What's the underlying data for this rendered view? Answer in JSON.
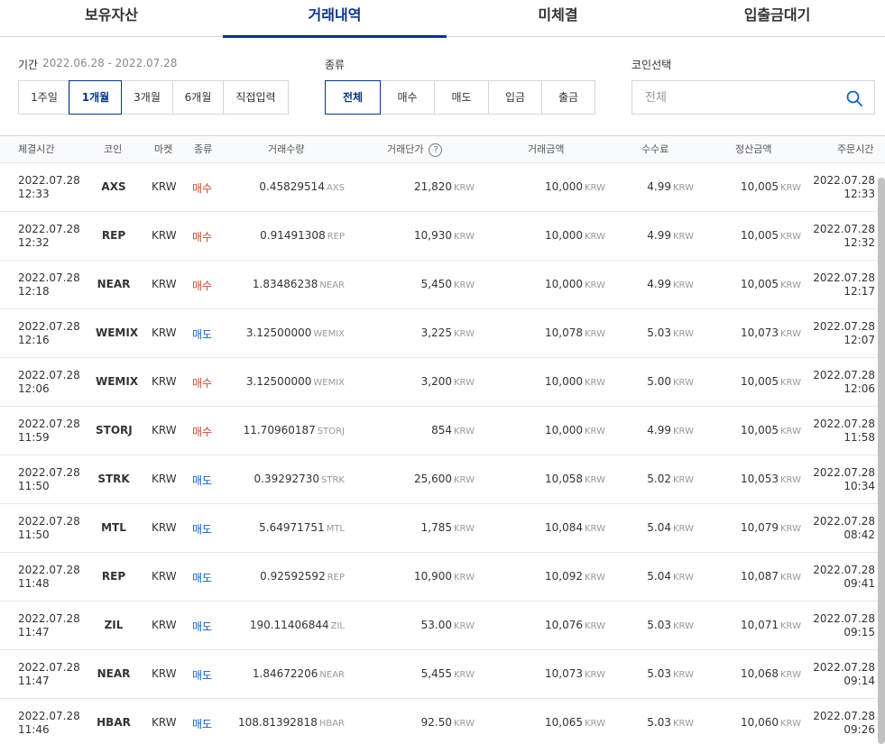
{
  "tabs": [
    {
      "label": "보유자산",
      "active": false
    },
    {
      "label": "거래내역",
      "active": true
    },
    {
      "label": "미체결",
      "active": false
    },
    {
      "label": "입출금대기",
      "active": false
    }
  ],
  "filters": {
    "period_label": "기간",
    "period_range": "2022.06.28 - 2022.07.28",
    "period_options": [
      "1주일",
      "1개월",
      "3개월",
      "6개월",
      "직접입력"
    ],
    "period_selected": "1개월",
    "type_label": "종류",
    "type_options": [
      "전체",
      "매수",
      "매도",
      "입금",
      "출금"
    ],
    "type_selected": "전체",
    "coin_label": "코인선택",
    "coin_placeholder": "전체"
  },
  "table": {
    "headers": {
      "time": "체결시간",
      "coin": "코인",
      "market": "마켓",
      "type": "종류",
      "qty": "거래수량",
      "price": "거래단가",
      "amount": "거래금액",
      "fee": "수수료",
      "settle": "정산금액",
      "order_time": "주문시간"
    },
    "help_glyph": "?",
    "rows": [
      {
        "date": "2022.07.28",
        "time": "12:33",
        "coin": "AXS",
        "market": "KRW",
        "type": "매수",
        "side": "buy",
        "qty": "0.45829514",
        "qty_unit": "AXS",
        "price": "21,820",
        "amount": "10,000",
        "fee": "4.99",
        "settle": "10,005",
        "unit": "KRW",
        "odate": "2022.07.28",
        "otime": "12:33"
      },
      {
        "date": "2022.07.28",
        "time": "12:32",
        "coin": "REP",
        "market": "KRW",
        "type": "매수",
        "side": "buy",
        "qty": "0.91491308",
        "qty_unit": "REP",
        "price": "10,930",
        "amount": "10,000",
        "fee": "4.99",
        "settle": "10,005",
        "unit": "KRW",
        "odate": "2022.07.28",
        "otime": "12:32"
      },
      {
        "date": "2022.07.28",
        "time": "12:18",
        "coin": "NEAR",
        "market": "KRW",
        "type": "매수",
        "side": "buy",
        "qty": "1.83486238",
        "qty_unit": "NEAR",
        "price": "5,450",
        "amount": "10,000",
        "fee": "4.99",
        "settle": "10,005",
        "unit": "KRW",
        "odate": "2022.07.28",
        "otime": "12:17"
      },
      {
        "date": "2022.07.28",
        "time": "12:16",
        "coin": "WEMIX",
        "market": "KRW",
        "type": "매도",
        "side": "sell",
        "qty": "3.12500000",
        "qty_unit": "WEMIX",
        "price": "3,225",
        "amount": "10,078",
        "fee": "5.03",
        "settle": "10,073",
        "unit": "KRW",
        "odate": "2022.07.28",
        "otime": "12:07"
      },
      {
        "date": "2022.07.28",
        "time": "12:06",
        "coin": "WEMIX",
        "market": "KRW",
        "type": "매수",
        "side": "buy",
        "qty": "3.12500000",
        "qty_unit": "WEMIX",
        "price": "3,200",
        "amount": "10,000",
        "fee": "5.00",
        "settle": "10,005",
        "unit": "KRW",
        "odate": "2022.07.28",
        "otime": "12:06"
      },
      {
        "date": "2022.07.28",
        "time": "11:59",
        "coin": "STORJ",
        "market": "KRW",
        "type": "매수",
        "side": "buy",
        "qty": "11.70960187",
        "qty_unit": "STORJ",
        "price": "854",
        "amount": "10,000",
        "fee": "4.99",
        "settle": "10,005",
        "unit": "KRW",
        "odate": "2022.07.28",
        "otime": "11:58"
      },
      {
        "date": "2022.07.28",
        "time": "11:50",
        "coin": "STRK",
        "market": "KRW",
        "type": "매도",
        "side": "sell",
        "qty": "0.39292730",
        "qty_unit": "STRK",
        "price": "25,600",
        "amount": "10,058",
        "fee": "5.02",
        "settle": "10,053",
        "unit": "KRW",
        "odate": "2022.07.28",
        "otime": "10:34"
      },
      {
        "date": "2022.07.28",
        "time": "11:50",
        "coin": "MTL",
        "market": "KRW",
        "type": "매도",
        "side": "sell",
        "qty": "5.64971751",
        "qty_unit": "MTL",
        "price": "1,785",
        "amount": "10,084",
        "fee": "5.04",
        "settle": "10,079",
        "unit": "KRW",
        "odate": "2022.07.28",
        "otime": "08:42"
      },
      {
        "date": "2022.07.28",
        "time": "11:48",
        "coin": "REP",
        "market": "KRW",
        "type": "매도",
        "side": "sell",
        "qty": "0.92592592",
        "qty_unit": "REP",
        "price": "10,900",
        "amount": "10,092",
        "fee": "5.04",
        "settle": "10,087",
        "unit": "KRW",
        "odate": "2022.07.28",
        "otime": "09:41"
      },
      {
        "date": "2022.07.28",
        "time": "11:47",
        "coin": "ZIL",
        "market": "KRW",
        "type": "매도",
        "side": "sell",
        "qty": "190.11406844",
        "qty_unit": "ZIL",
        "price": "53.00",
        "amount": "10,076",
        "fee": "5.03",
        "settle": "10,071",
        "unit": "KRW",
        "odate": "2022.07.28",
        "otime": "09:15"
      },
      {
        "date": "2022.07.28",
        "time": "11:47",
        "coin": "NEAR",
        "market": "KRW",
        "type": "매도",
        "side": "sell",
        "qty": "1.84672206",
        "qty_unit": "NEAR",
        "price": "5,455",
        "amount": "10,073",
        "fee": "5.03",
        "settle": "10,068",
        "unit": "KRW",
        "odate": "2022.07.28",
        "otime": "09:14"
      },
      {
        "date": "2022.07.28",
        "time": "11:46",
        "coin": "HBAR",
        "market": "KRW",
        "type": "매도",
        "side": "sell",
        "qty": "108.81392818",
        "qty_unit": "HBAR",
        "price": "92.50",
        "amount": "10,065",
        "fee": "5.03",
        "settle": "10,060",
        "unit": "KRW",
        "odate": "2022.07.28",
        "otime": "09:26"
      }
    ]
  },
  "colors": {
    "accent": "#093687",
    "buy": "#c84a31",
    "sell": "#1261c4",
    "unit": "#999999"
  },
  "icons": {
    "search": "search-icon",
    "help": "help-icon"
  }
}
